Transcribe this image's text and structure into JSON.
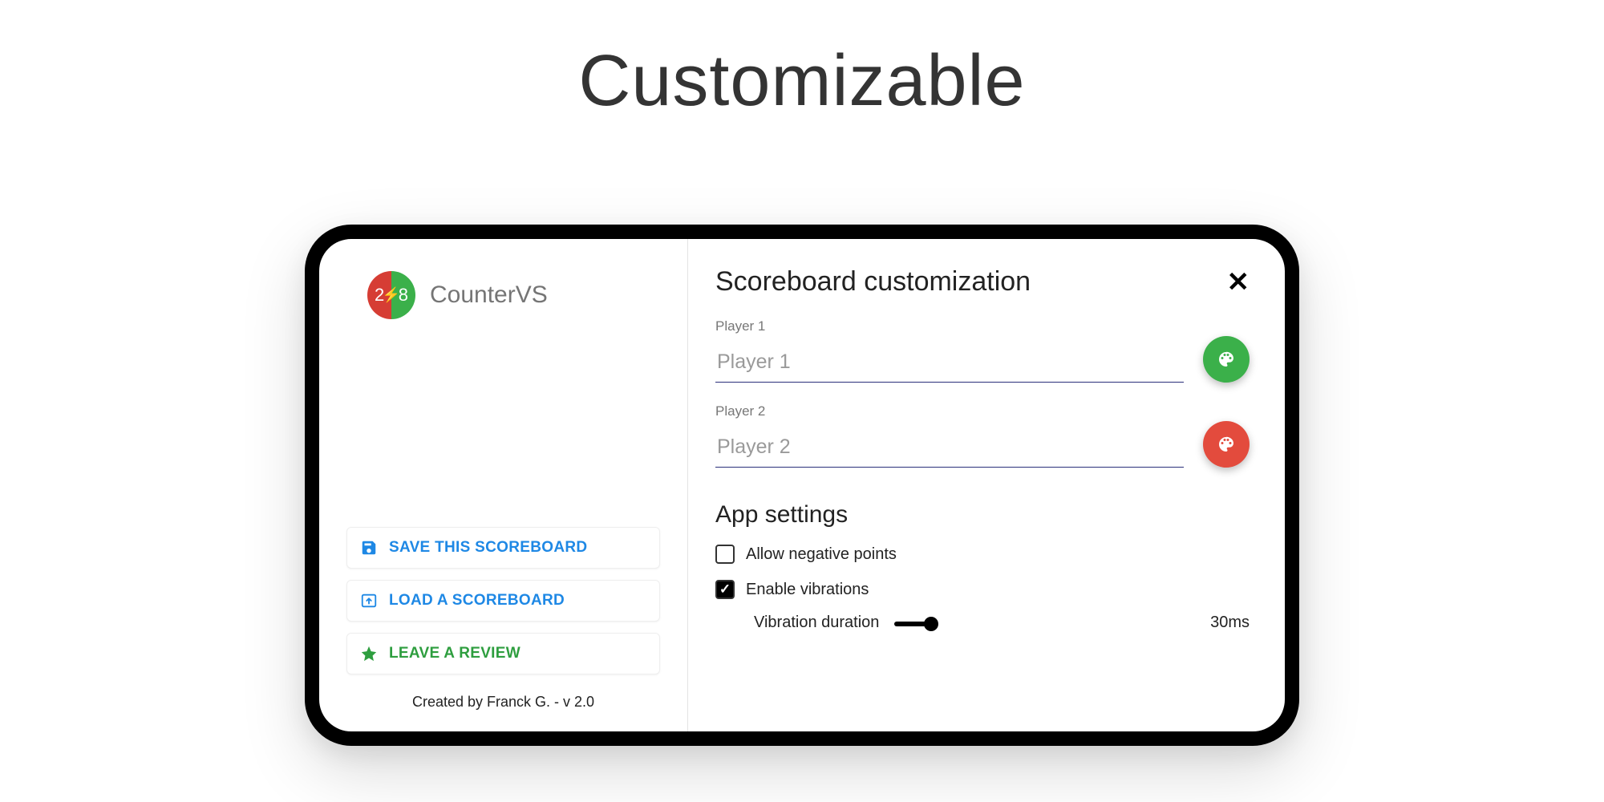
{
  "hero": {
    "title": "Customizable"
  },
  "brand": {
    "name": "CounterVS",
    "logo_left_num": "2",
    "logo_right_num": "8"
  },
  "sidebar": {
    "save_label": "SAVE THIS SCOREBOARD",
    "load_label": "LOAD A SCOREBOARD",
    "review_label": "LEAVE A REVIEW",
    "credit": "Created by Franck G. - v 2.0"
  },
  "main": {
    "title": "Scoreboard customization",
    "player1_label": "Player 1",
    "player1_placeholder": "Player 1",
    "player2_label": "Player 2",
    "player2_placeholder": "Player 2",
    "settings_title": "App settings",
    "allow_negative_label": "Allow negative points",
    "allow_negative_checked": false,
    "enable_vibrations_label": "Enable vibrations",
    "enable_vibrations_checked": true,
    "vibration_duration_label": "Vibration duration",
    "vibration_duration_value": "30ms"
  },
  "colors": {
    "fab_green": "#3bb04a",
    "fab_red": "#e34b3d",
    "action_blue": "#1e88e5",
    "action_green": "#2e9e3f"
  }
}
